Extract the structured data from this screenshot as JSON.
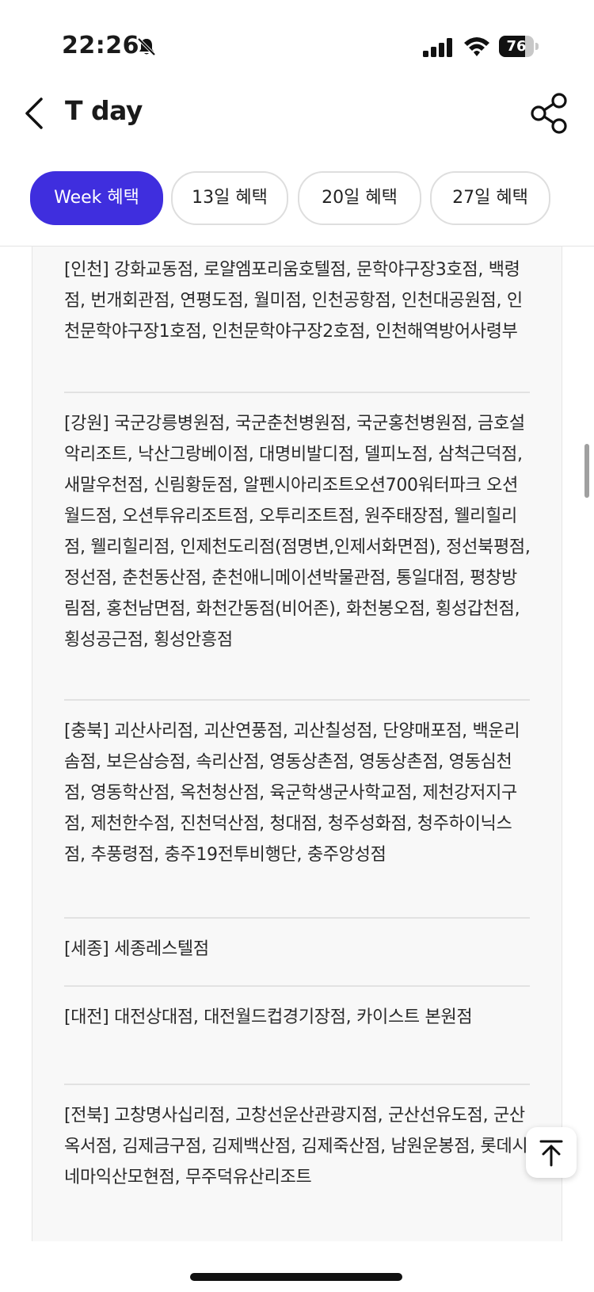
{
  "status": {
    "time": "22:26",
    "battery": "76",
    "battery_level": 0.76
  },
  "header": {
    "title": "T day"
  },
  "tabs": [
    {
      "label": "Week 혜택",
      "active": true
    },
    {
      "label": "13일 혜택",
      "active": false
    },
    {
      "label": "20일 혜택",
      "active": false
    },
    {
      "label": "27일 혜택",
      "active": false
    }
  ],
  "regions": [
    {
      "text": "[인천] 강화교동점, 로얄엠포리움호텔점, 문학야구장3호점, 백령점, 번개회관점, 연평도점, 월미점, 인천공항점, 인천대공원점, 인천문학야구장1호점, 인천문학야구장2호점, 인천해역방어사령부"
    },
    {
      "text": "[강원] 국군강릉병원점, 국군춘천병원점, 국군홍천병원점, 금호설악리조트, 낙산그랑베이점, 대명비발디점, 델피노점, 삼척근덕점, 새말우천점, 신림황둔점, 알펜시아리조트오션700워터파크 오션월드점, 오션투유리조트점, 오투리조트점, 원주태장점, 웰리힐리점, 웰리힐리점, 인제천도리점(점명변,인제서화면점), 정선북평점, 정선점, 춘천동산점, 춘천애니메이션박물관점, 통일대점, 평창방림점, 홍천남면점, 화천간동점(비어존), 화천봉오점, 횡성갑천점, 횡성공근점, 횡성안흥점"
    },
    {
      "text": "[충북] 괴산사리점, 괴산연풍점, 괴산칠성점, 단양매포점, 백운리솜점, 보은삼승점, 속리산점, 영동상촌점, 영동상촌점, 영동심천점, 영동학산점, 옥천청산점, 육군학생군사학교점, 제천강저지구점, 제천한수점, 진천덕산점, 청대점, 청주성화점, 청주하이닉스점, 추풍령점, 충주19전투비행단, 충주앙성점"
    },
    {
      "text": "[세종] 세종레스텔점"
    },
    {
      "text": "[대전] 대전상대점, 대전월드컵경기장점, 카이스트 본원점"
    },
    {
      "text": "[전북] 고창명사십리점, 고창선운산관광지점, 군산선유도점, 군산옥서점, 김제금구점, 김제백산점, 김제죽산점, 남원운봉점, 롯데시네마익산모현점, 무주덕유산리조트"
    }
  ]
}
